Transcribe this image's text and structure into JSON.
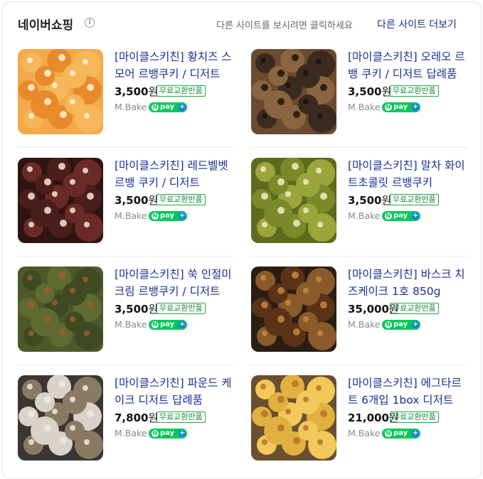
{
  "header": {
    "title": "네이버쇼핑",
    "hint": "다른 사이트를 보시려면 클릭하세요",
    "more_link": "다른 사이트 더보기"
  },
  "items": [
    {
      "name": "[마이클스키친] 황치즈 스모어 르뱅쿠키 / 디저트",
      "price": "3,500",
      "won": "원",
      "badge": "무료교환반품",
      "seller": "M.Bake",
      "npay": "pay",
      "thumb": "cheese"
    },
    {
      "name": "[마이클스키친] 오레오 르뱅 쿠키 / 디저트 답례품",
      "price": "3,500",
      "won": "원",
      "badge": "무료교환반품",
      "seller": "M.Bake",
      "npay": "pay",
      "thumb": "oreo"
    },
    {
      "name": "[마이클스키친] 레드벨벳 르뱅 쿠키 / 디저트",
      "price": "3,500",
      "won": "원",
      "badge": "무료교환반품",
      "seller": "M.Bake",
      "npay": "pay",
      "thumb": "redvelvet"
    },
    {
      "name": "[마이클스키친] 말차 화이트초콜릿 르뱅쿠키",
      "price": "3,500",
      "won": "원",
      "badge": "무료교환반품",
      "seller": "M.Bake",
      "npay": "pay",
      "thumb": "matcha"
    },
    {
      "name": "[마이클스키친] 쑥 인절미크림 르뱅쿠키 / 디저트",
      "price": "3,500",
      "won": "원",
      "badge": "무료교환반품",
      "seller": "M.Bake",
      "npay": "pay",
      "thumb": "mugwort"
    },
    {
      "name": "[마이클스키친] 바스크 치즈케이크 1호 850g",
      "price": "35,000",
      "won": "원",
      "badge": "무료교환반품",
      "seller": "M.Bake",
      "npay": "pay",
      "thumb": "basque"
    },
    {
      "name": "[마이클스키친] 파운드 케이크 디저트 답례품",
      "price": "7,800",
      "won": "원",
      "badge": "무료교환반품",
      "seller": "M.Bake",
      "npay": "pay",
      "thumb": "pound"
    },
    {
      "name": "[마이클스키친] 에그타르트 6개입 1box 디저트",
      "price": "21,000",
      "won": "원",
      "badge": "무료교환반품",
      "seller": "M.Bake",
      "npay": "pay",
      "thumb": "eggtart"
    }
  ],
  "colors": {
    "link": "#1a2f96",
    "badge_green": "#2aa14f",
    "npay_green": "#03c75a"
  }
}
